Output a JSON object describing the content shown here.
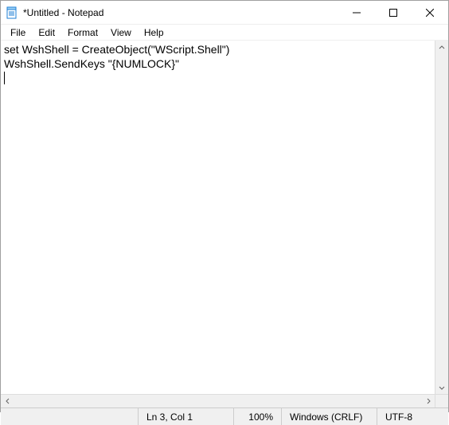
{
  "window": {
    "title": "*Untitled - Notepad"
  },
  "menu": {
    "items": [
      "File",
      "Edit",
      "Format",
      "View",
      "Help"
    ]
  },
  "editor": {
    "content": "set WshShell = CreateObject(\"WScript.Shell\")\nWshShell.SendKeys \"{NUMLOCK}\"\n"
  },
  "status": {
    "position": "Ln 3, Col 1",
    "zoom": "100%",
    "eol": "Windows (CRLF)",
    "encoding": "UTF-8"
  }
}
